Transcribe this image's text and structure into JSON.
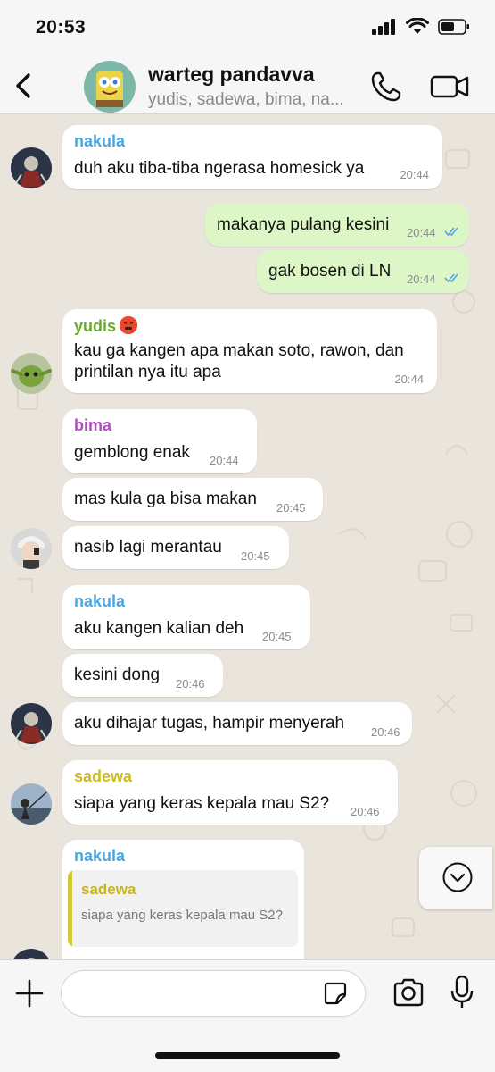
{
  "status_bar": {
    "time": "20:53"
  },
  "header": {
    "title": "warteg pandavva",
    "members": "yudis, sadewa, bima, na..."
  },
  "colors": {
    "nakula": "#4aa7e0",
    "yudis": "#6aab2e",
    "bima": "#b04bc0",
    "sadewa": "#cdbb1f",
    "outgoing_bubble": "#dcf7c5",
    "read_ticks": "#4fa6e6"
  },
  "messages": [
    {
      "sender": "nakula",
      "text": "duh aku tiba-tiba ngerasa homesick ya",
      "time": "20:44"
    },
    {
      "sender": "me",
      "text": "makanya pulang kesini",
      "time": "20:44",
      "status": "read"
    },
    {
      "sender": "me",
      "text": "gak bosen di LN",
      "time": "20:44",
      "status": "read"
    },
    {
      "sender": "yudis",
      "text_line1": "kau ga kangen apa makan soto, rawon, dan",
      "text_line2": "printilan nya itu apa",
      "time": "20:44"
    },
    {
      "sender": "bima",
      "text": "gemblong enak",
      "time": "20:44"
    },
    {
      "sender": "bima",
      "text": "mas kula ga bisa makan",
      "time": "20:45"
    },
    {
      "sender": "bima",
      "text": "nasib lagi merantau",
      "time": "20:45"
    },
    {
      "sender": "nakula",
      "text": "aku kangen kalian deh",
      "time": "20:45"
    },
    {
      "sender": "nakula",
      "text": "kesini dong",
      "time": "20:46"
    },
    {
      "sender": "nakula",
      "text": "aku dihajar tugas, hampir menyerah",
      "time": "20:46"
    },
    {
      "sender": "sadewa",
      "text": "siapa yang keras kepala mau S2?",
      "time": "20:46"
    },
    {
      "sender": "nakula",
      "quote": {
        "sender": "sadewa",
        "text": "siapa yang keras kepala mau S2?"
      }
    }
  ],
  "icons": {
    "back": "chevron-left-icon",
    "call": "phone-icon",
    "video": "video-camera-icon",
    "scroll": "chevron-down-circle-icon",
    "add": "plus-icon",
    "sticker": "sticker-icon",
    "camera": "camera-icon",
    "mic": "microphone-icon"
  },
  "composer": {
    "placeholder": ""
  }
}
